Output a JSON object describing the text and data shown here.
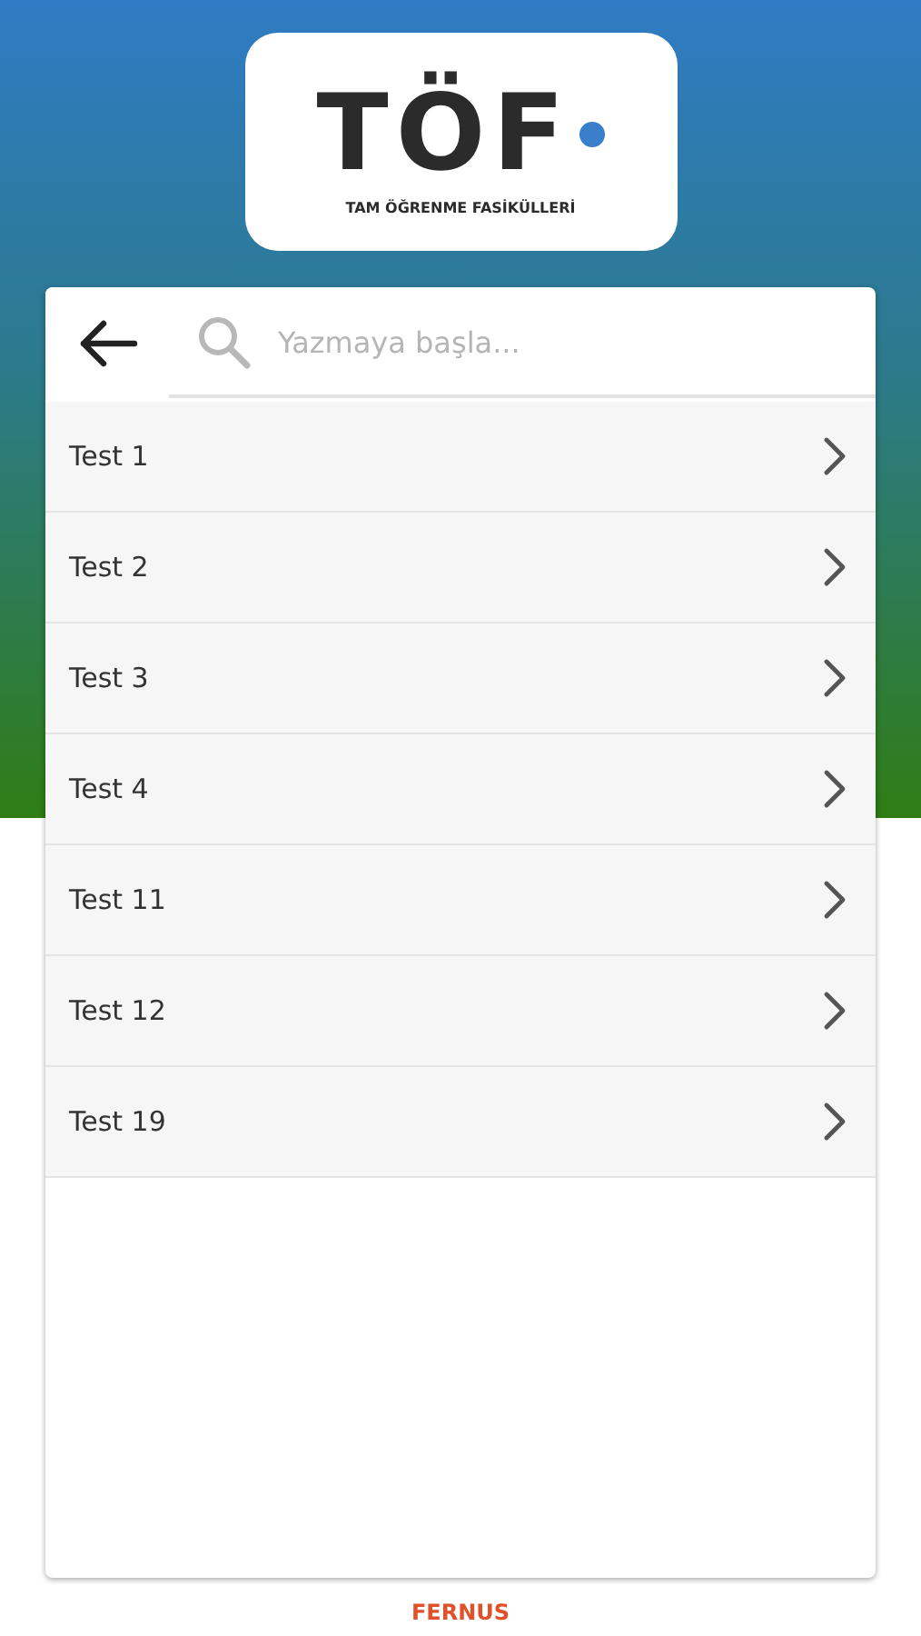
{
  "logo": {
    "title": "TÖF",
    "subtitle": "TAM ÖĞRENME FASİKÜLLERİ"
  },
  "search": {
    "placeholder": "Yazmaya başla..."
  },
  "items": [
    {
      "label": "Test 1"
    },
    {
      "label": "Test 2"
    },
    {
      "label": "Test 3"
    },
    {
      "label": "Test 4"
    },
    {
      "label": "Test 11"
    },
    {
      "label": "Test 12"
    },
    {
      "label": "Test 19"
    }
  ],
  "footer": "FERNUS"
}
